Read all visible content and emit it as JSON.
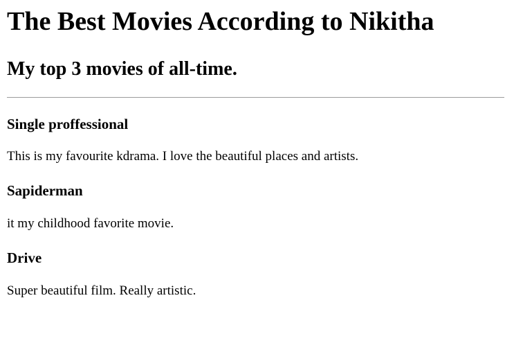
{
  "page": {
    "title": "The Best Movies According to Nikitha",
    "subtitle": "My top 3 movies of all-time."
  },
  "movies": [
    {
      "title": "Single proffessional",
      "description": "This is my favourite kdrama. I love the beautiful places and artists."
    },
    {
      "title": "Sapiderman",
      "description": "it my childhood favorite movie."
    },
    {
      "title": "Drive",
      "description": "Super beautiful film. Really artistic."
    }
  ]
}
